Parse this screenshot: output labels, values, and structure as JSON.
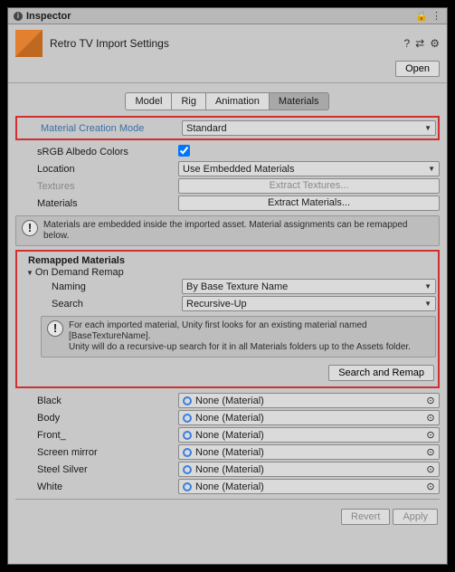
{
  "titlebar": {
    "title": "Inspector",
    "lock_icon": "🔒",
    "menu_icon": "⋮"
  },
  "header": {
    "asset_name": "Retro TV Import Settings",
    "help_icon": "?",
    "preset_icon": "⇄",
    "settings_icon": "⚙",
    "open_btn": "Open"
  },
  "tabs": [
    {
      "label": "Model",
      "active": false
    },
    {
      "label": "Rig",
      "active": false
    },
    {
      "label": "Animation",
      "active": false
    },
    {
      "label": "Materials",
      "active": true
    }
  ],
  "mat_mode": {
    "label": "Material Creation Mode",
    "value": "Standard"
  },
  "srgb": {
    "label": "sRGB Albedo Colors",
    "checked": true
  },
  "location": {
    "label": "Location",
    "value": "Use Embedded Materials"
  },
  "textures": {
    "label": "Textures",
    "btn": "Extract Textures..."
  },
  "materials": {
    "label": "Materials",
    "btn": "Extract Materials..."
  },
  "info1": "Materials are embedded inside the imported asset. Material assignments can be remapped below.",
  "remap": {
    "section": "Remapped Materials",
    "foldout": "On Demand Remap",
    "naming_label": "Naming",
    "naming_value": "By Base Texture Name",
    "search_label": "Search",
    "search_value": "Recursive-Up",
    "info2": "For each imported material, Unity first looks for an existing material named [BaseTextureName].\nUnity will do a recursive-up search for it in all Materials folders up to the Assets folder.",
    "search_remap_btn": "Search and Remap"
  },
  "slots": [
    {
      "name": "Black",
      "value": "None (Material)"
    },
    {
      "name": "Body",
      "value": "None (Material)"
    },
    {
      "name": "Front_",
      "value": "None (Material)"
    },
    {
      "name": "Screen mirror",
      "value": "None (Material)"
    },
    {
      "name": "Steel Silver",
      "value": "None (Material)"
    },
    {
      "name": "White",
      "value": "None (Material)"
    }
  ],
  "footer": {
    "revert": "Revert",
    "apply": "Apply"
  }
}
